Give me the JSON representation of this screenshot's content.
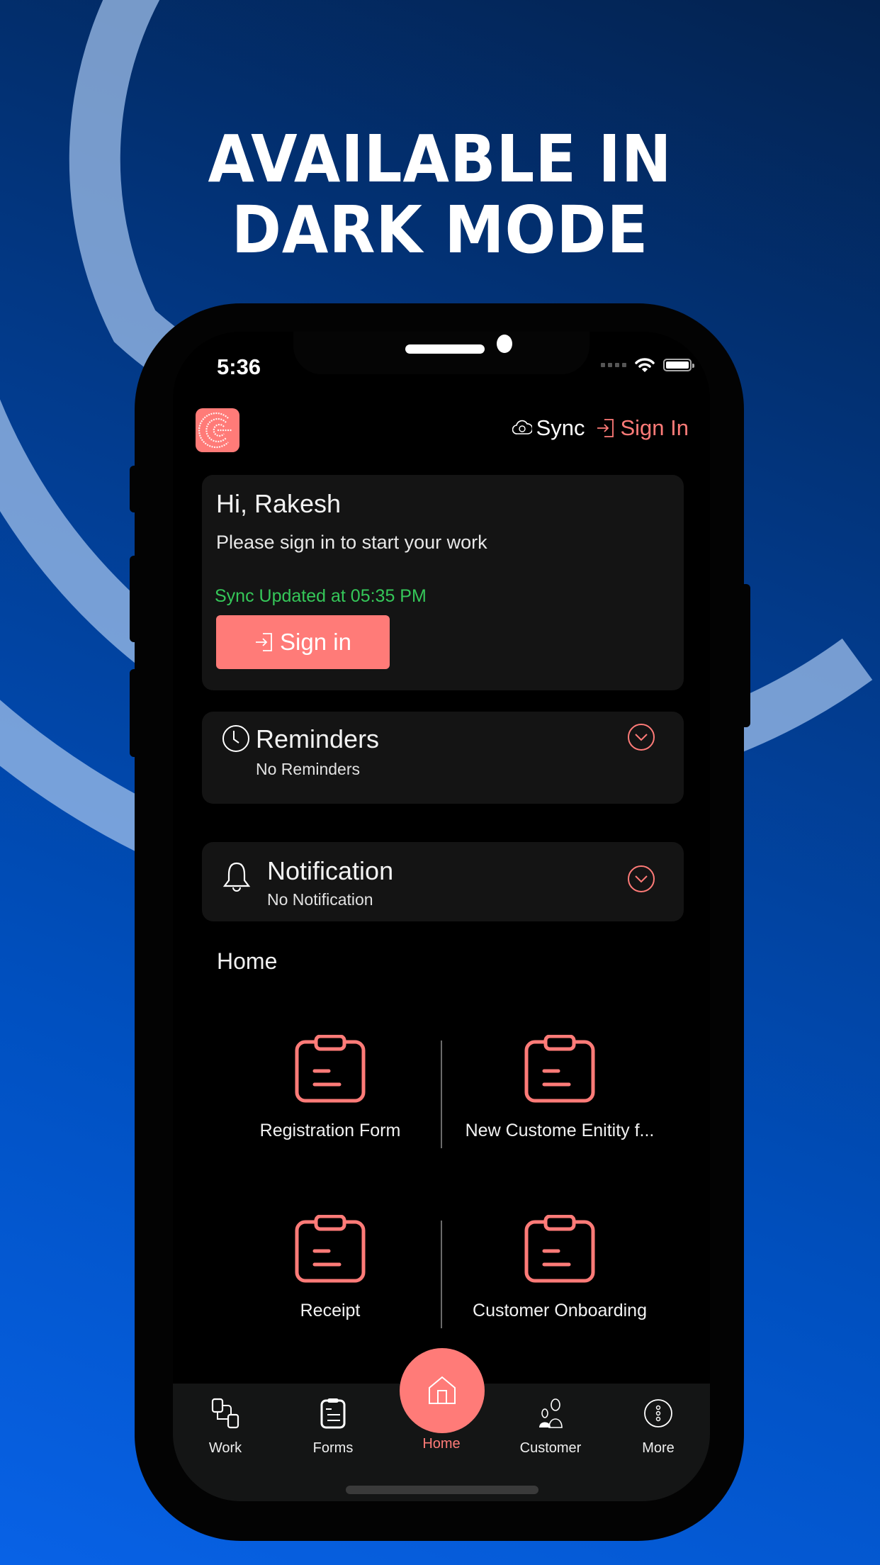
{
  "promo": {
    "headline_line1": "AVAILABLE IN",
    "headline_line2": "DARK MODE"
  },
  "status_bar": {
    "time": "5:36",
    "wifi": "wifi-icon",
    "battery": "battery-full-icon"
  },
  "header": {
    "logo": "app-logo-icon",
    "sync_label": "Sync",
    "signin_label": "Sign In"
  },
  "welcome": {
    "greeting": "Hi, Rakesh",
    "prompt": "Please sign in to start your work",
    "sync_status": "Sync Updated at 05:35 PM",
    "signin_button": "Sign in"
  },
  "reminders": {
    "title": "Reminders",
    "subtitle": "No Reminders"
  },
  "notification": {
    "title": "Notification",
    "subtitle": "No Notification"
  },
  "home": {
    "section_title": "Home",
    "items": [
      {
        "label": "Registration Form",
        "icon": "clipboard-icon"
      },
      {
        "label": "New Custome Enitity f...",
        "icon": "clipboard-icon"
      },
      {
        "label": "Receipt",
        "icon": "clipboard-icon"
      },
      {
        "label": "Customer Onboarding",
        "icon": "clipboard-icon"
      }
    ]
  },
  "tabbar": {
    "tabs": [
      {
        "label": "Work",
        "icon": "workflow-icon"
      },
      {
        "label": "Forms",
        "icon": "forms-icon"
      },
      {
        "label": "Home",
        "icon": "home-icon",
        "active": true
      },
      {
        "label": "Customer",
        "icon": "customers-icon"
      },
      {
        "label": "More",
        "icon": "more-icon"
      }
    ]
  },
  "colors": {
    "accent": "#ff7b78",
    "success": "#35c759",
    "card": "#141414",
    "background_top": "#03224f",
    "background_bottom": "#0862e6"
  }
}
